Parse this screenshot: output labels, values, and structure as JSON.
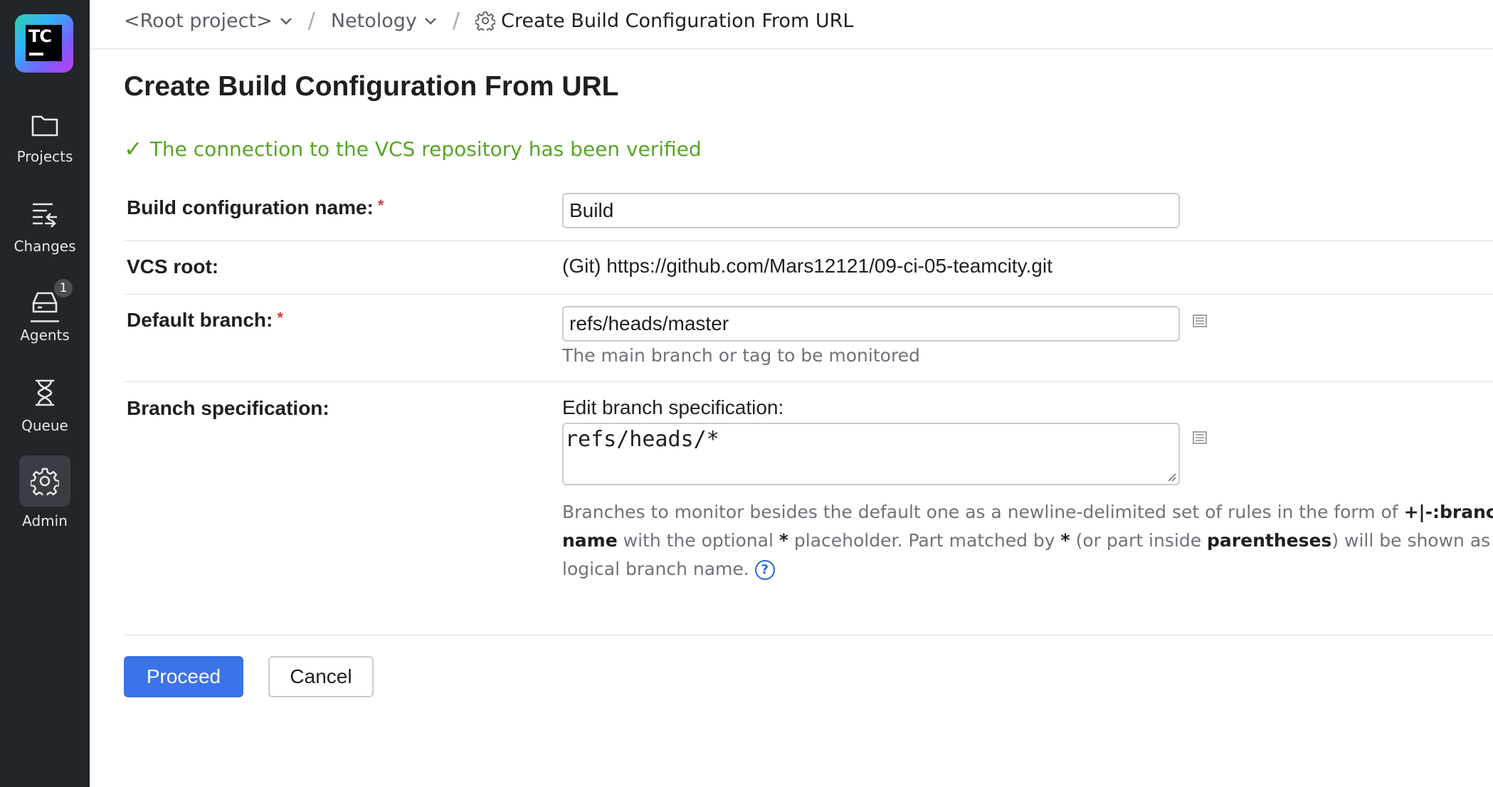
{
  "logo": {
    "text": "TC"
  },
  "sidebar": {
    "items": [
      {
        "label": "Projects",
        "icon": "folder-icon"
      },
      {
        "label": "Changes",
        "icon": "changes-icon"
      },
      {
        "label": "Agents",
        "icon": "agents-icon",
        "badge": "1"
      },
      {
        "label": "Queue",
        "icon": "hourglass-icon"
      },
      {
        "label": "Admin",
        "icon": "gear-icon",
        "active": true
      }
    ]
  },
  "breadcrumb": {
    "root": "<Root project>",
    "project": "Netology",
    "current": "Create Build Configuration From URL"
  },
  "page": {
    "title": "Create Build Configuration From URL",
    "verified_message": "The connection to the VCS repository has been verified"
  },
  "form": {
    "build_name_label": "Build configuration name:",
    "build_name_value": "Build",
    "vcs_root_label": "VCS root:",
    "vcs_root_value": "(Git) https://github.com/Mars12121/09-ci-05-teamcity.git",
    "default_branch_label": "Default branch:",
    "default_branch_value": "refs/heads/master",
    "default_branch_help": "The main branch or tag to be monitored",
    "branch_spec_label": "Branch specification:",
    "branch_spec_edit_label": "Edit branch specification:",
    "branch_spec_value": "refs/heads/*",
    "branch_spec_help": {
      "p1": "Branches to monitor besides the default one as a newline-delimited set of rules in the form of ",
      "b1": "+|-:branch name",
      "p2": " with the optional ",
      "b2": "*",
      "p3": " placeholder. Part matched by ",
      "b3": "*",
      "p4": " (or part inside ",
      "b4": "parentheses",
      "p5": ") will be shown as a build logical branch name."
    },
    "required_mark": "*"
  },
  "buttons": {
    "proceed": "Proceed",
    "cancel": "Cancel"
  },
  "colors": {
    "sidebar_bg": "#22252a",
    "accent": "#3b73e8",
    "success": "#57a524",
    "required": "#d8383d"
  }
}
